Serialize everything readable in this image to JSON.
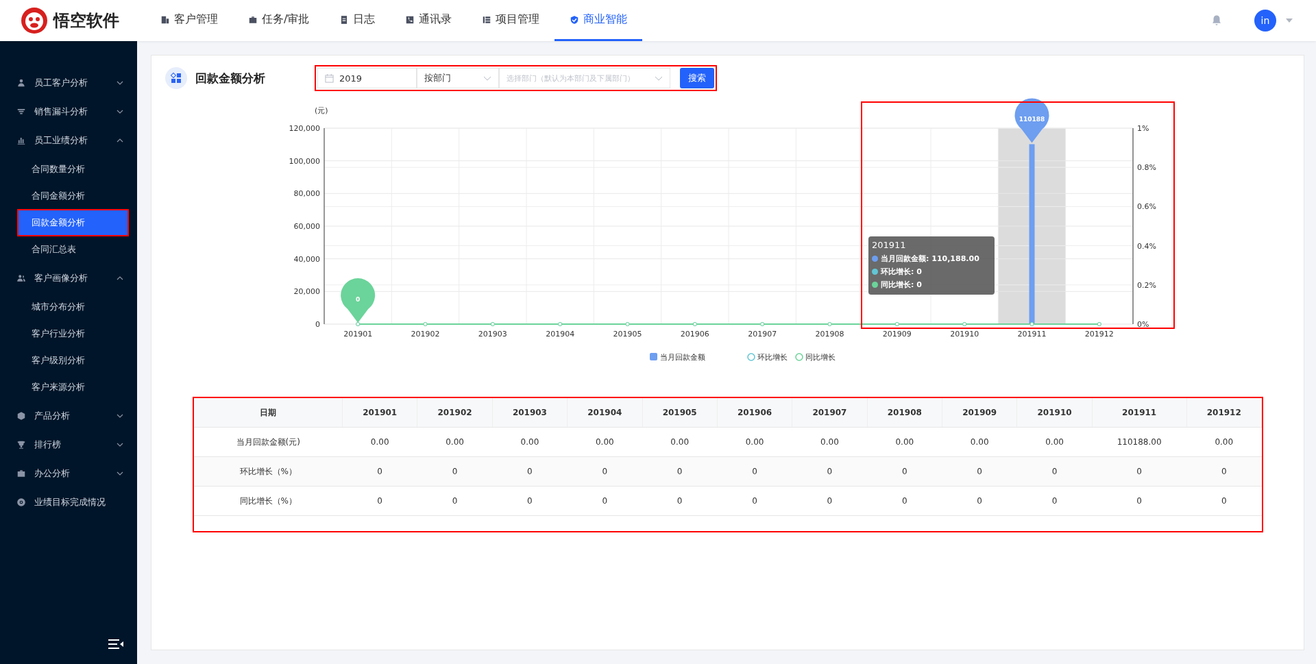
{
  "brand": {
    "name": "悟空软件"
  },
  "nav": [
    {
      "label": "客户管理",
      "selected": false
    },
    {
      "label": "任务/审批",
      "selected": false
    },
    {
      "label": "日志",
      "selected": false
    },
    {
      "label": "通讯录",
      "selected": false
    },
    {
      "label": "项目管理",
      "selected": false
    },
    {
      "label": "商业智能",
      "selected": true
    }
  ],
  "user": {
    "avatar": "in"
  },
  "sidebar": {
    "items": [
      {
        "label": "员工客户分析",
        "expanded": false
      },
      {
        "label": "销售漏斗分析",
        "expanded": false
      },
      {
        "label": "员工业绩分析",
        "expanded": true,
        "children": [
          {
            "label": "合同数量分析",
            "selected": false,
            "highlighted": false
          },
          {
            "label": "合同金额分析",
            "selected": false,
            "highlighted": false
          },
          {
            "label": "回款金额分析",
            "selected": true,
            "highlighted": true
          },
          {
            "label": "合同汇总表",
            "selected": false,
            "highlighted": false
          }
        ]
      },
      {
        "label": "客户画像分析",
        "expanded": true,
        "children": [
          {
            "label": "城市分布分析",
            "selected": false,
            "highlighted": false
          },
          {
            "label": "客户行业分析",
            "selected": false,
            "highlighted": false
          },
          {
            "label": "客户级别分析",
            "selected": false,
            "highlighted": false
          },
          {
            "label": "客户来源分析",
            "selected": false,
            "highlighted": false
          }
        ]
      },
      {
        "label": "产品分析",
        "expanded": false
      },
      {
        "label": "排行榜",
        "expanded": false
      },
      {
        "label": "办公分析",
        "expanded": false
      },
      {
        "label": "业绩目标完成情况"
      }
    ]
  },
  "page": {
    "title": "回款金额分析"
  },
  "filter": {
    "highlighted": true,
    "year": {
      "value": "2019"
    },
    "group": {
      "value": "按部门"
    },
    "department": {
      "placeholder": "选择部门（默认为本部门及下属部门）"
    },
    "search_button": "搜索"
  },
  "chart": {
    "highlighted": true,
    "right_axis_ticks": [
      "1%",
      "0.8%",
      "0.6%",
      "0.4%",
      "0.2%",
      "0%"
    ],
    "chart_data": {
      "type": "bar",
      "ylabel": "(元)",
      "grid": true,
      "categories": [
        "201901",
        "201902",
        "201903",
        "201904",
        "201905",
        "201906",
        "201907",
        "201908",
        "201909",
        "201910",
        "201911",
        "201912"
      ],
      "series": [
        {
          "name": "当月回款金额",
          "color": "#6d9ef0",
          "values": [
            0,
            0,
            0,
            0,
            0,
            0,
            0,
            0,
            0,
            0,
            110188,
            0
          ]
        },
        {
          "name": "环比增长",
          "color": "#62c6d4",
          "values": [
            0,
            0,
            0,
            0,
            0,
            0,
            0,
            0,
            0,
            0,
            0,
            0
          ]
        },
        {
          "name": "同比增长",
          "color": "#6bd49a",
          "values": [
            0,
            0,
            0,
            0,
            0,
            0,
            0,
            0,
            0,
            0,
            0,
            0
          ]
        }
      ],
      "ylim": [
        0,
        120000
      ],
      "yticks": [
        {
          "value": 0,
          "label": "0"
        },
        {
          "value": 20000,
          "label": "20,000"
        },
        {
          "value": 40000,
          "label": "40,000"
        },
        {
          "value": 60000,
          "label": "60,000"
        },
        {
          "value": 80000,
          "label": "80,000"
        },
        {
          "value": 100000,
          "label": "100,000"
        },
        {
          "value": 120000,
          "label": "120,000"
        }
      ],
      "annotations": [
        "0",
        "110188"
      ]
    },
    "tooltip": {
      "title": "201911",
      "rows": [
        {
          "text": "当月回款金额: 110,188.00",
          "color": "#6d9ef0"
        },
        {
          "text": "环比增长: 0",
          "color": "#62c6d4"
        },
        {
          "text": "同比增长: 0",
          "color": "#6bd49a"
        }
      ]
    }
  },
  "table": {
    "highlighted": true,
    "columns": [
      "日期",
      "201901",
      "201902",
      "201903",
      "201904",
      "201905",
      "201906",
      "201907",
      "201908",
      "201909",
      "201910",
      "201911",
      "201912"
    ],
    "rows": [
      {
        "cells": [
          "当月回款金额(元)",
          "0.00",
          "0.00",
          "0.00",
          "0.00",
          "0.00",
          "0.00",
          "0.00",
          "0.00",
          "0.00",
          "0.00",
          "110188.00",
          "0.00"
        ]
      },
      {
        "cells": [
          "环比增长（%）",
          "0",
          "0",
          "0",
          "0",
          "0",
          "0",
          "0",
          "0",
          "0",
          "0",
          "0",
          "0"
        ]
      },
      {
        "cells": [
          "同比增长（%）",
          "0",
          "0",
          "0",
          "0",
          "0",
          "0",
          "0",
          "0",
          "0",
          "0",
          "0",
          "0"
        ]
      }
    ]
  }
}
